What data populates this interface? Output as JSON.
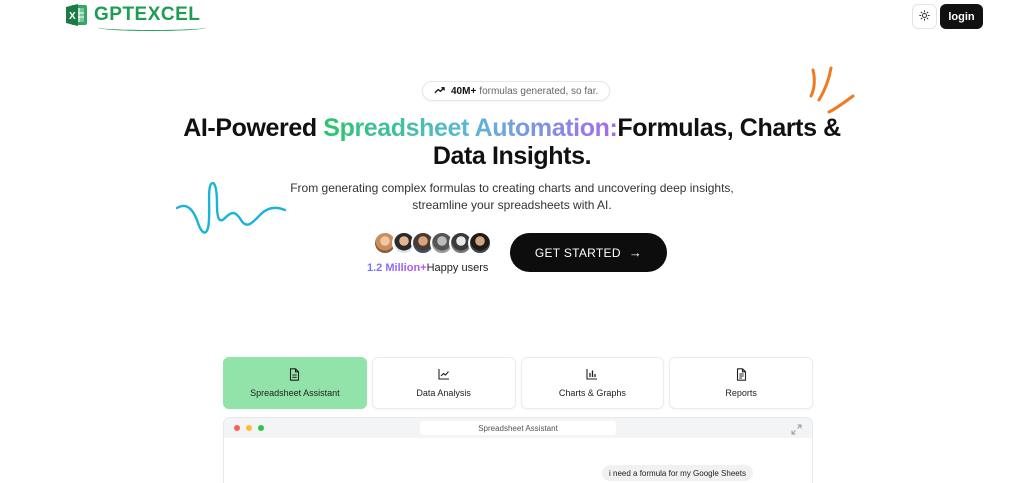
{
  "header": {
    "brand": "GPTEXCEL",
    "login_label": "login",
    "icons": {
      "logo": "excel-logo-icon",
      "theme": "sun-icon"
    }
  },
  "hero": {
    "stat_value": "40M+",
    "stat_text": "formulas generated, so far.",
    "title_part1": "AI-Powered ",
    "title_highlight": "Spreadsheet Automation:",
    "title_part2": "Formulas, Charts & Data Insights.",
    "subtitle": "From generating complex formulas to creating charts and uncovering deep insights, streamline your spreadsheets with AI.",
    "users_count": "1.2 Million+",
    "users_label": "Happy users",
    "cta_label": "GET STARTED",
    "cta_icon": "arrow-right-icon"
  },
  "tabs": [
    {
      "label": "Spreadsheet Assistant",
      "icon": "document-icon",
      "active": true
    },
    {
      "label": "Data Analysis",
      "icon": "line-chart-icon",
      "active": false
    },
    {
      "label": "Charts & Graphs",
      "icon": "bar-chart-icon",
      "active": false
    },
    {
      "label": "Reports",
      "icon": "report-icon",
      "active": false
    }
  ],
  "preview": {
    "window_title": "Spreadsheet Assistant",
    "chat_message": "i need a formula for my Google Sheets"
  },
  "colors": {
    "brand_green": "#1f9d55",
    "active_tab": "#92e3a9",
    "accent_cyan": "#19b4d6",
    "accent_orange": "#f07a22"
  }
}
